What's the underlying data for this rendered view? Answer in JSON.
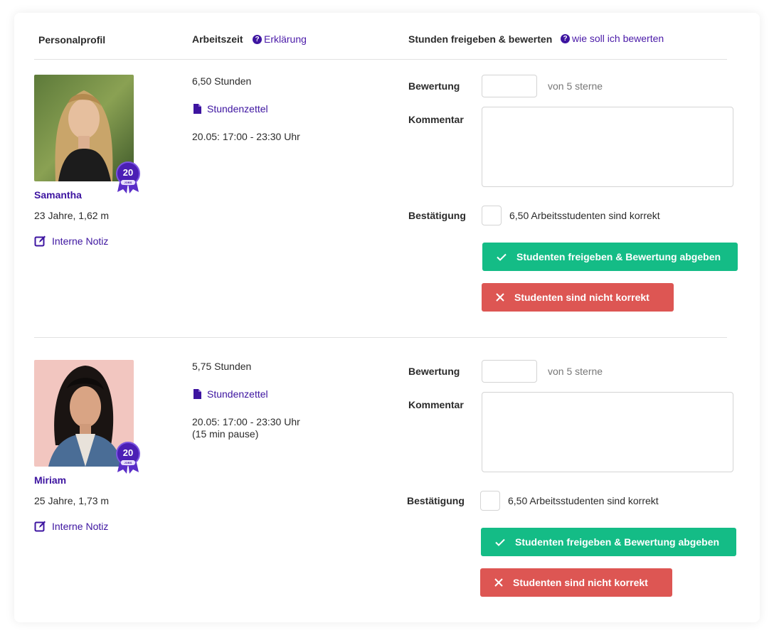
{
  "header": {
    "col_profile": "Personalprofil",
    "col_time": "Arbeitszeit",
    "time_help": "Erklärung",
    "col_rate": "Stunden freigeben & bewerten",
    "rate_help": "wie soll ich bewerten",
    "help_icon": "?"
  },
  "rows": [
    {
      "name": "Samantha",
      "details": "23 Jahre, 1,62 m",
      "note_link": "Interne Notiz",
      "badge_number": "20",
      "badge_label": "JOBS",
      "hours": "6,50 Stunden",
      "timesheet": "Stundenzettel",
      "shift": "20.05: 17:00 - 23:30 Uhr",
      "pause": "",
      "rating_label": "Bewertung",
      "rating_value": "",
      "rating_suffix": "von 5 sterne",
      "comment_label": "Kommentar",
      "comment_value": "",
      "confirm_label": "Bestätigung",
      "confirm_text": "6,50 Arbeitsstudenten sind korrekt",
      "approve_button": "Studenten freigeben & Bewertung abgeben",
      "reject_button": "Studenten sind nicht korrekt"
    },
    {
      "name": "Miriam",
      "details": "25 Jahre, 1,73 m",
      "note_link": "Interne Notiz",
      "badge_number": "20",
      "badge_label": "JOBS",
      "hours": "5,75 Stunden",
      "timesheet": "Stundenzettel",
      "shift": "20.05: 17:00 - 23:30 Uhr",
      "pause": "(15 min pause)",
      "rating_label": "Bewertung",
      "rating_value": "",
      "rating_suffix": "von 5 sterne",
      "comment_label": "Kommentar",
      "comment_value": "",
      "confirm_label": "Bestätigung",
      "confirm_text": "6,50 Arbeitsstudenten sind korrekt",
      "approve_button": "Studenten freigeben & Bewertung abgeben",
      "reject_button": "Studenten sind nicht korrekt"
    }
  ],
  "colors": {
    "accent": "#3d14a0",
    "approve": "#14bc86",
    "reject": "#dd5653"
  }
}
